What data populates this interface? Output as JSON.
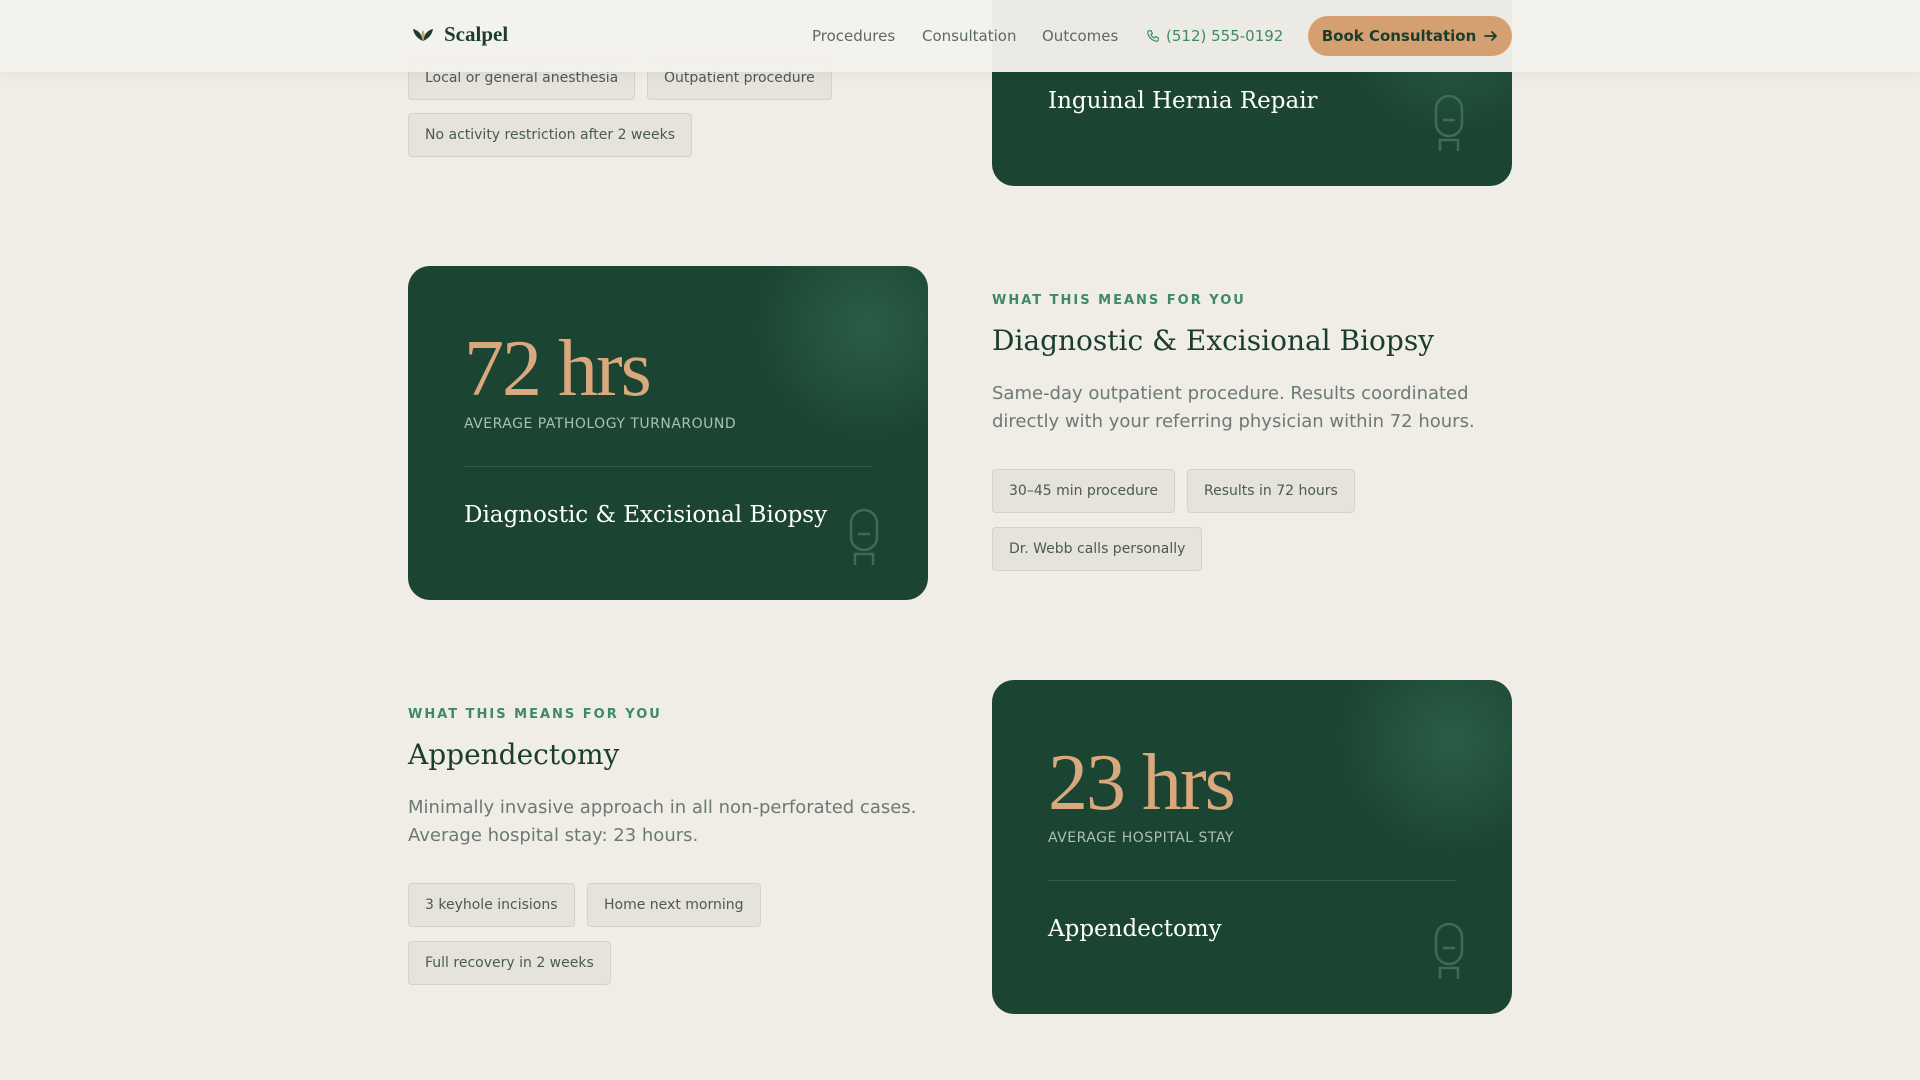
{
  "header": {
    "brand": "Scalpel",
    "nav": [
      "Procedures",
      "Consultation",
      "Outcomes"
    ],
    "phone": "(512) 555-0192",
    "cta": "Book Consultation"
  },
  "hernia": {
    "tags": [
      "Local or general anesthesia",
      "Outpatient procedure",
      "No activity restriction after 2 weeks"
    ],
    "card_title": "Inguinal Hernia Repair"
  },
  "biopsy": {
    "stat": "72 hrs",
    "stat_label": "AVERAGE PATHOLOGY TURNAROUND",
    "card_title": "Diagnostic & Excisional Biopsy",
    "eyebrow": "WHAT THIS MEANS FOR YOU",
    "title": "Diagnostic & Excisional Biopsy",
    "description": "Same-day outpatient procedure. Results coordinated directly with your referring physician within 72 hours.",
    "tags": [
      "30–45 min procedure",
      "Results in 72 hours",
      "Dr. Webb calls personally"
    ]
  },
  "appendectomy": {
    "eyebrow": "WHAT THIS MEANS FOR YOU",
    "title": "Appendectomy",
    "description": "Minimally invasive approach in all non-perforated cases. Average hospital stay: 23 hours.",
    "tags": [
      "3 keyhole incisions",
      "Home next morning",
      "Full recovery in 2 weeks"
    ],
    "stat": "23 hrs",
    "stat_label": "AVERAGE HOSPITAL STAY",
    "card_title": "Appendectomy"
  }
}
